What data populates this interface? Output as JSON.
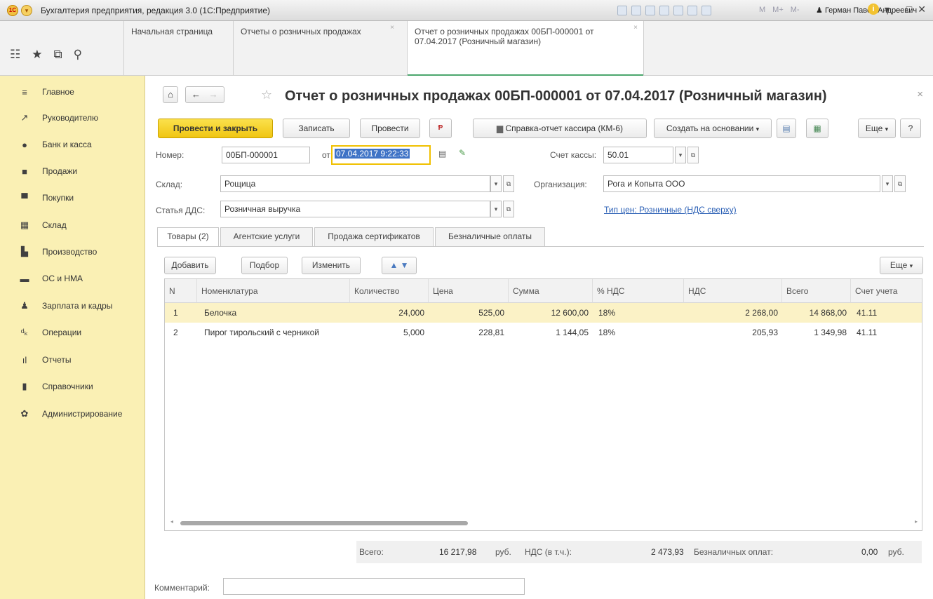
{
  "window": {
    "title": "Бухгалтерия предприятия, редакция 3.0  (1С:Предприятие)",
    "user": "Герман Павел Андреевич",
    "m_labels": [
      "M",
      "M+",
      "M-"
    ]
  },
  "tabs": [
    {
      "label": "Начальная страница"
    },
    {
      "label": "Отчеты о розничных продажах"
    },
    {
      "label_line1": "Отчет о розничных продажах 00БП-000001 от",
      "label_line2": "07.04.2017 (Розничный магазин)"
    }
  ],
  "sidebar": {
    "items": [
      {
        "label": "Главное",
        "icon": "menu-lines-icon"
      },
      {
        "label": "Руководителю",
        "icon": "chart-line-icon"
      },
      {
        "label": "Банк и касса",
        "icon": "ruble-coin-icon"
      },
      {
        "label": "Продажи",
        "icon": "shopping-bag-icon"
      },
      {
        "label": "Покупки",
        "icon": "cart-icon"
      },
      {
        "label": "Склад",
        "icon": "warehouse-grid-icon"
      },
      {
        "label": "Производство",
        "icon": "factory-icon"
      },
      {
        "label": "ОС и НМА",
        "icon": "truck-icon"
      },
      {
        "label": "Зарплата и кадры",
        "icon": "person-icon"
      },
      {
        "label": "Операции",
        "icon": "dt-kt-icon"
      },
      {
        "label": "Отчеты",
        "icon": "bar-chart-icon"
      },
      {
        "label": "Справочники",
        "icon": "book-icon"
      },
      {
        "label": "Администрирование",
        "icon": "gear-icon"
      }
    ]
  },
  "document": {
    "title": "Отчет о розничных продажах 00БП-000001 от 07.04.2017 (Розничный магазин)"
  },
  "toolbar": {
    "post_close": "Провести и закрыть",
    "save": "Записать",
    "post": "Провести",
    "cashier_report": "Справка-отчет кассира (КМ-6)",
    "create_based": "Создать на основании",
    "more": "Еще",
    "help": "?"
  },
  "form": {
    "number_label": "Номер:",
    "number_value": "00БП-000001",
    "from_label": "от:",
    "date_value": "07.04.2017  9:22:33",
    "cash_account_label": "Счет кассы:",
    "cash_account_value": "50.01",
    "warehouse_label": "Склад:",
    "warehouse_value": "Рощица",
    "organization_label": "Организация:",
    "organization_value": "Рога и Копыта ООО",
    "dds_label": "Статья ДДС:",
    "dds_value": "Розничная выручка",
    "price_type_link": "Тип цен: Розничные (НДС сверху)"
  },
  "panel_tabs": [
    "Товары (2)",
    "Агентские услуги",
    "Продажа сертификатов",
    "Безналичные оплаты"
  ],
  "table_toolbar": {
    "add": "Добавить",
    "pick": "Подбор",
    "edit": "Изменить",
    "more": "Еще"
  },
  "table": {
    "headers": [
      "N",
      "Номенклатура",
      "Количество",
      "Цена",
      "Сумма",
      "% НДС",
      "НДС",
      "Всего",
      "Счет учета"
    ],
    "rows": [
      [
        "1",
        "Белочка",
        "24,000",
        "525,00",
        "12 600,00",
        "18%",
        "2 268,00",
        "14 868,00",
        "41.11"
      ],
      [
        "2",
        "Пирог тирольский с черникой",
        "5,000",
        "228,81",
        "1 144,05",
        "18%",
        "205,93",
        "1 349,98",
        "41.11"
      ]
    ]
  },
  "footer": {
    "total_label": "Всего:",
    "total_value": "16 217,98",
    "currency": "руб.",
    "vat_label": "НДС (в т.ч.):",
    "vat_value": "2 473,93",
    "noncash_label": "Безналичных оплат:",
    "noncash_value": "0,00",
    "currency2": "руб."
  },
  "comment": {
    "label": "Комментарий:",
    "value": ""
  },
  "colors": {
    "sidebar_bg": "#faf0b4",
    "primary_button": "#f0c512",
    "active_tab_underline": "#4aa66c",
    "selected_row": "#fbf2c6",
    "link": "#2a5fb5"
  }
}
